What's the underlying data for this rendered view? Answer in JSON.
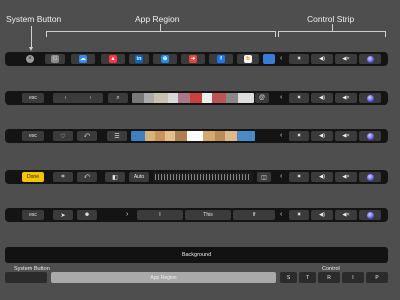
{
  "headers": {
    "system_button": "System Button",
    "app_region": "App Region",
    "control_strip": "Control Strip"
  },
  "row2": {
    "esc": "esc",
    "back": "‹",
    "forward": "›"
  },
  "row3": {
    "esc": "esc"
  },
  "row4": {
    "done": "Done",
    "auto": "Auto"
  },
  "row5": {
    "esc": "esc",
    "suggestions": [
      "I",
      "This",
      "If"
    ]
  },
  "background_label": "Background",
  "legend": {
    "system_button": "System Button",
    "control": "Control",
    "app_region": "App Region",
    "control_keys": [
      "S",
      "T",
      "R",
      "I",
      "P"
    ]
  },
  "colors": {
    "touchbar": "#141414",
    "key": "#3b3b3b",
    "done": "#f5c400",
    "screen_bg": "#4e4e4e",
    "legend_app": "#a9a9a9",
    "legend_control": "#2b2b2b"
  },
  "apps": [
    {
      "name": "finder-app",
      "color": "#8b8b8b",
      "glyph": ""
    },
    {
      "name": "icloud-app",
      "color": "#2a8df0",
      "glyph": "☁"
    },
    {
      "name": "news-app",
      "color": "#ff3344",
      "glyph": "▲"
    },
    {
      "name": "linkedin-app",
      "color": "#0a66c2",
      "glyph": "in"
    },
    {
      "name": "app-store-app",
      "color": "#1c8cf5",
      "glyph": "⊕"
    },
    {
      "name": "maps-app",
      "color": "#e8443a",
      "glyph": "➜"
    },
    {
      "name": "facebook-app",
      "color": "#1877f2",
      "glyph": "f"
    },
    {
      "name": "bing-app",
      "color": "#f5f5f5",
      "glyph": "b"
    }
  ]
}
